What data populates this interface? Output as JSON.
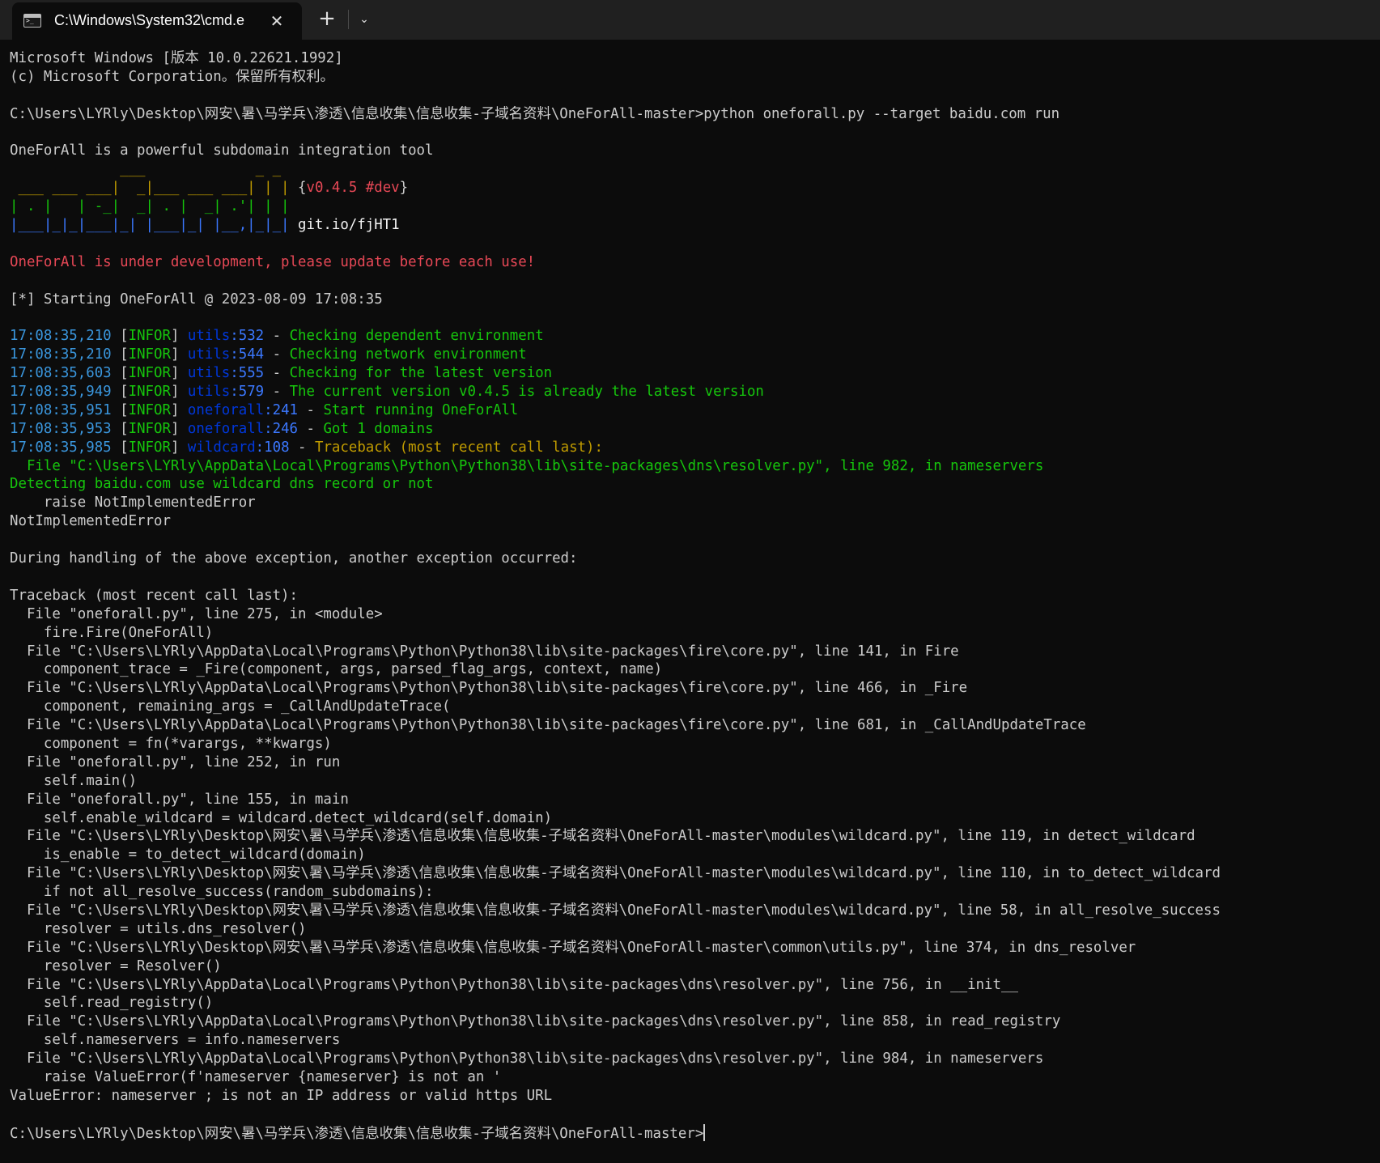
{
  "tab": {
    "title": "C:\\Windows\\System32\\cmd.e",
    "close_glyph": "✕",
    "new_tab_glyph": "+",
    "dropdown_glyph": "⌄",
    "icon": "terminal-icon"
  },
  "colors": {
    "background": "#0c0c0c",
    "titlebar": "#202020",
    "default_text": "#cccccc",
    "red": "#e74856",
    "green": "#16c60c",
    "cyan": "#3a96dd",
    "blue": "#0037da",
    "light_blue": "#3b78ff",
    "yellow": "#f9f1a5"
  },
  "lines": [
    [
      {
        "t": "Microsoft Windows [版本 10.0.22621.1992]"
      }
    ],
    [
      {
        "t": "(c) Microsoft Corporation。保留所有权利。"
      }
    ],
    [],
    [
      {
        "t": "C:\\Users\\LYRly\\Desktop\\网安\\暑\\马学兵\\渗透\\信息收集\\信息收集-子域名资料\\OneForAll-master>python oneforall.py --target baidu.com run"
      }
    ],
    [],
    [
      {
        "t": "OneForAll is a powerful subdomain integration tool"
      }
    ],
    [
      {
        "t": "             ___             _ _",
        "c": "gold"
      }
    ],
    [
      {
        "t": " ___ ___ ___|  _|___ ___ ___| | | ",
        "c": "gold"
      },
      {
        "t": "{"
      },
      {
        "t": "v0.4.5 #dev",
        "c": "red"
      },
      {
        "t": "}"
      }
    ],
    [
      {
        "t": "| . |   | -_|  _| . |  _| .'| | |",
        "c": "grn"
      }
    ],
    [
      {
        "t": "|___|_|_|___|_| |___|_| |__,|_|_| ",
        "c": "lblu"
      },
      {
        "t": "git.io/fjHT1",
        "c": "white"
      }
    ],
    [],
    [
      {
        "t": "OneForAll is under development, please update before each use!",
        "c": "red"
      }
    ],
    [],
    [
      {
        "t": "[*] Starting OneForAll @ 2023-08-09 17:08:35"
      }
    ],
    [],
    [
      {
        "t": "17:08:35,210",
        "c": "cyan"
      },
      {
        "t": " [",
        "c": "def"
      },
      {
        "t": "INFOR",
        "c": "grn"
      },
      {
        "t": "] ",
        "c": "def"
      },
      {
        "t": "utils",
        "c": "blu"
      },
      {
        "t": ":532",
        "c": "lblu"
      },
      {
        "t": " - ",
        "c": "def"
      },
      {
        "t": "Checking dependent environment",
        "c": "grn"
      }
    ],
    [
      {
        "t": "17:08:35,210",
        "c": "cyan"
      },
      {
        "t": " [",
        "c": "def"
      },
      {
        "t": "INFOR",
        "c": "grn"
      },
      {
        "t": "] ",
        "c": "def"
      },
      {
        "t": "utils",
        "c": "blu"
      },
      {
        "t": ":544",
        "c": "lblu"
      },
      {
        "t": " - ",
        "c": "def"
      },
      {
        "t": "Checking network environment",
        "c": "grn"
      }
    ],
    [
      {
        "t": "17:08:35,603",
        "c": "cyan"
      },
      {
        "t": " [",
        "c": "def"
      },
      {
        "t": "INFOR",
        "c": "grn"
      },
      {
        "t": "] ",
        "c": "def"
      },
      {
        "t": "utils",
        "c": "blu"
      },
      {
        "t": ":555",
        "c": "lblu"
      },
      {
        "t": " - ",
        "c": "def"
      },
      {
        "t": "Checking for the latest version",
        "c": "grn"
      }
    ],
    [
      {
        "t": "17:08:35,949",
        "c": "cyan"
      },
      {
        "t": " [",
        "c": "def"
      },
      {
        "t": "INFOR",
        "c": "grn"
      },
      {
        "t": "] ",
        "c": "def"
      },
      {
        "t": "utils",
        "c": "blu"
      },
      {
        "t": ":579",
        "c": "lblu"
      },
      {
        "t": " - ",
        "c": "def"
      },
      {
        "t": "The current version v0.4.5 is already the latest version",
        "c": "grn"
      }
    ],
    [
      {
        "t": "17:08:35,951",
        "c": "cyan"
      },
      {
        "t": " [",
        "c": "def"
      },
      {
        "t": "INFOR",
        "c": "grn"
      },
      {
        "t": "] ",
        "c": "def"
      },
      {
        "t": "oneforall",
        "c": "blu"
      },
      {
        "t": ":241",
        "c": "lblu"
      },
      {
        "t": " - ",
        "c": "def"
      },
      {
        "t": "Start running OneForAll",
        "c": "grn"
      }
    ],
    [
      {
        "t": "17:08:35,953",
        "c": "cyan"
      },
      {
        "t": " [",
        "c": "def"
      },
      {
        "t": "INFOR",
        "c": "grn"
      },
      {
        "t": "] ",
        "c": "def"
      },
      {
        "t": "oneforall",
        "c": "blu"
      },
      {
        "t": ":246",
        "c": "lblu"
      },
      {
        "t": " - ",
        "c": "def"
      },
      {
        "t": "Got 1 domains",
        "c": "grn"
      }
    ],
    [
      {
        "t": "17:08:35,985",
        "c": "cyan"
      },
      {
        "t": " [",
        "c": "def"
      },
      {
        "t": "INFOR",
        "c": "grn"
      },
      {
        "t": "] ",
        "c": "def"
      },
      {
        "t": "wildcard",
        "c": "blu"
      },
      {
        "t": ":108",
        "c": "lblu"
      },
      {
        "t": " - ",
        "c": "def"
      },
      {
        "t": "Traceback (most recent call last):",
        "c": "gold"
      }
    ],
    [
      {
        "t": "  File \"C:\\Users\\LYRly\\AppData\\Local\\Programs\\Python\\Python38\\lib\\site-packages\\dns\\resolver.py\", line 982, in nameservers",
        "c": "grn"
      }
    ],
    [
      {
        "t": "Detecting baidu.com use wildcard dns record or not",
        "c": "grn"
      }
    ],
    [
      {
        "t": "    raise NotImplementedError"
      }
    ],
    [
      {
        "t": "NotImplementedError"
      }
    ],
    [],
    [
      {
        "t": "During handling of the above exception, another exception occurred:"
      }
    ],
    [],
    [
      {
        "t": "Traceback (most recent call last):"
      }
    ],
    [
      {
        "t": "  File \"oneforall.py\", line 275, in <module>"
      }
    ],
    [
      {
        "t": "    fire.Fire(OneForAll)"
      }
    ],
    [
      {
        "t": "  File \"C:\\Users\\LYRly\\AppData\\Local\\Programs\\Python\\Python38\\lib\\site-packages\\fire\\core.py\", line 141, in Fire"
      }
    ],
    [
      {
        "t": "    component_trace = _Fire(component, args, parsed_flag_args, context, name)"
      }
    ],
    [
      {
        "t": "  File \"C:\\Users\\LYRly\\AppData\\Local\\Programs\\Python\\Python38\\lib\\site-packages\\fire\\core.py\", line 466, in _Fire"
      }
    ],
    [
      {
        "t": "    component, remaining_args = _CallAndUpdateTrace("
      }
    ],
    [
      {
        "t": "  File \"C:\\Users\\LYRly\\AppData\\Local\\Programs\\Python\\Python38\\lib\\site-packages\\fire\\core.py\", line 681, in _CallAndUpdateTrace"
      }
    ],
    [
      {
        "t": "    component = fn(*varargs, **kwargs)"
      }
    ],
    [
      {
        "t": "  File \"oneforall.py\", line 252, in run"
      }
    ],
    [
      {
        "t": "    self.main()"
      }
    ],
    [
      {
        "t": "  File \"oneforall.py\", line 155, in main"
      }
    ],
    [
      {
        "t": "    self.enable_wildcard = wildcard.detect_wildcard(self.domain)"
      }
    ],
    [
      {
        "t": "  File \"C:\\Users\\LYRly\\Desktop\\网安\\暑\\马学兵\\渗透\\信息收集\\信息收集-子域名资料\\OneForAll-master\\modules\\wildcard.py\", line 119, in detect_wildcard"
      }
    ],
    [
      {
        "t": "    is_enable = to_detect_wildcard(domain)"
      }
    ],
    [
      {
        "t": "  File \"C:\\Users\\LYRly\\Desktop\\网安\\暑\\马学兵\\渗透\\信息收集\\信息收集-子域名资料\\OneForAll-master\\modules\\wildcard.py\", line 110, in to_detect_wildcard"
      }
    ],
    [
      {
        "t": "    if not all_resolve_success(random_subdomains):"
      }
    ],
    [
      {
        "t": "  File \"C:\\Users\\LYRly\\Desktop\\网安\\暑\\马学兵\\渗透\\信息收集\\信息收集-子域名资料\\OneForAll-master\\modules\\wildcard.py\", line 58, in all_resolve_success"
      }
    ],
    [
      {
        "t": "    resolver = utils.dns_resolver()"
      }
    ],
    [
      {
        "t": "  File \"C:\\Users\\LYRly\\Desktop\\网安\\暑\\马学兵\\渗透\\信息收集\\信息收集-子域名资料\\OneForAll-master\\common\\utils.py\", line 374, in dns_resolver"
      }
    ],
    [
      {
        "t": "    resolver = Resolver()"
      }
    ],
    [
      {
        "t": "  File \"C:\\Users\\LYRly\\AppData\\Local\\Programs\\Python\\Python38\\lib\\site-packages\\dns\\resolver.py\", line 756, in __init__"
      }
    ],
    [
      {
        "t": "    self.read_registry()"
      }
    ],
    [
      {
        "t": "  File \"C:\\Users\\LYRly\\AppData\\Local\\Programs\\Python\\Python38\\lib\\site-packages\\dns\\resolver.py\", line 858, in read_registry"
      }
    ],
    [
      {
        "t": "    self.nameservers = info.nameservers"
      }
    ],
    [
      {
        "t": "  File \"C:\\Users\\LYRly\\AppData\\Local\\Programs\\Python\\Python38\\lib\\site-packages\\dns\\resolver.py\", line 984, in nameservers"
      }
    ],
    [
      {
        "t": "    raise ValueError(f'nameserver {nameserver} is not an '"
      }
    ],
    [
      {
        "t": "ValueError: nameserver ; is not an IP address or valid https URL"
      }
    ],
    [],
    [
      {
        "t": "C:\\Users\\LYRly\\Desktop\\网安\\暑\\马学兵\\渗透\\信息收集\\信息收集-子域名资料\\OneForAll-master>"
      }
    ]
  ]
}
